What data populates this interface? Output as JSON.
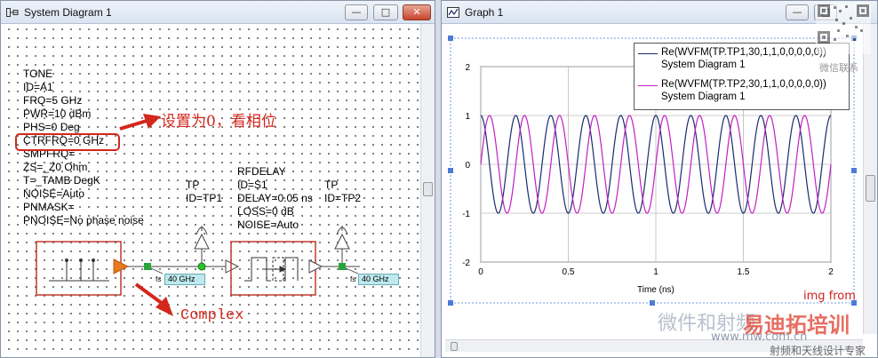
{
  "sysdiag": {
    "title": "System Diagram 1",
    "buttons": {
      "min": "—",
      "max": "□",
      "close": "✕"
    },
    "tone": {
      "lines": [
        "TONE",
        "ID=A1",
        "FRQ=5 GHz",
        "PWR=10 dBm",
        "PHS=0 Deg",
        "CTRFRQ=0 GHz",
        "SMPFRQ=",
        "ZS=_Z0 Ohm",
        "T=_TAMB DegK",
        "NOISE=Auto",
        "PNMASK=",
        "PNOISE=No phase noise"
      ]
    },
    "tp1": {
      "lines": [
        "TP",
        "ID=TP1"
      ]
    },
    "rfdelay": {
      "lines": [
        "RFDELAY",
        "ID=S1",
        "DELAY=0.05 ns",
        "LOSS=0 dB",
        "NOISE=Auto"
      ]
    },
    "tp2": {
      "lines": [
        "TP",
        "ID=TP2"
      ]
    },
    "freq_tag_1": "40 GHz",
    "freq_tag_2": "40 GHz",
    "fs_label": "fs",
    "annotation_phase": "设置为0，看相位",
    "annotation_complex": "Complex",
    "annotation_color": "#d4271d"
  },
  "graph": {
    "title": "Graph 1",
    "buttons": {
      "min": "—",
      "max": "□",
      "close": "✕"
    },
    "legend": [
      {
        "expr": "Re(WVFM(TP.TP1,30,1,1,0,0,0,0,0))",
        "source": "System Diagram 1",
        "color": "#1c2a6e"
      },
      {
        "expr": "Re(WVFM(TP.TP2,30,1,1,0,0,0,0,0))",
        "source": "System Diagram 1",
        "color": "#c21fc2"
      }
    ],
    "xlabel": "Time (ns)"
  },
  "chart_data": {
    "type": "line",
    "title": "",
    "xlabel": "Time (ns)",
    "ylabel": "",
    "xlim": [
      0,
      2
    ],
    "ylim": [
      -2,
      2
    ],
    "xticks": [
      "0",
      "0.5",
      "1",
      "1.5",
      "2"
    ],
    "yticks": [
      "2",
      "1",
      "0",
      "-1",
      "-2"
    ],
    "grid": true,
    "legend_position": "top-right",
    "series": [
      {
        "name": "Re(WVFM(TP.TP1,30,1,1,0,0,0,0,0))",
        "color": "#1c2a6e",
        "frequency_ghz": 5,
        "amplitude": 1,
        "phase_deg": 0
      },
      {
        "name": "Re(WVFM(TP.TP2,30,1,1,0,0,0,0,0))",
        "color": "#c21fc2",
        "frequency_ghz": 5,
        "amplitude": 1,
        "delay_ns": 0.05
      }
    ]
  },
  "watermark": {
    "img_from": "img from",
    "cn_text": "微信联系",
    "url": "www.mw.com.cn",
    "brand": "射频和天线设计专家",
    "logo": "易迪拓培训",
    "script": "微件和射频"
  }
}
